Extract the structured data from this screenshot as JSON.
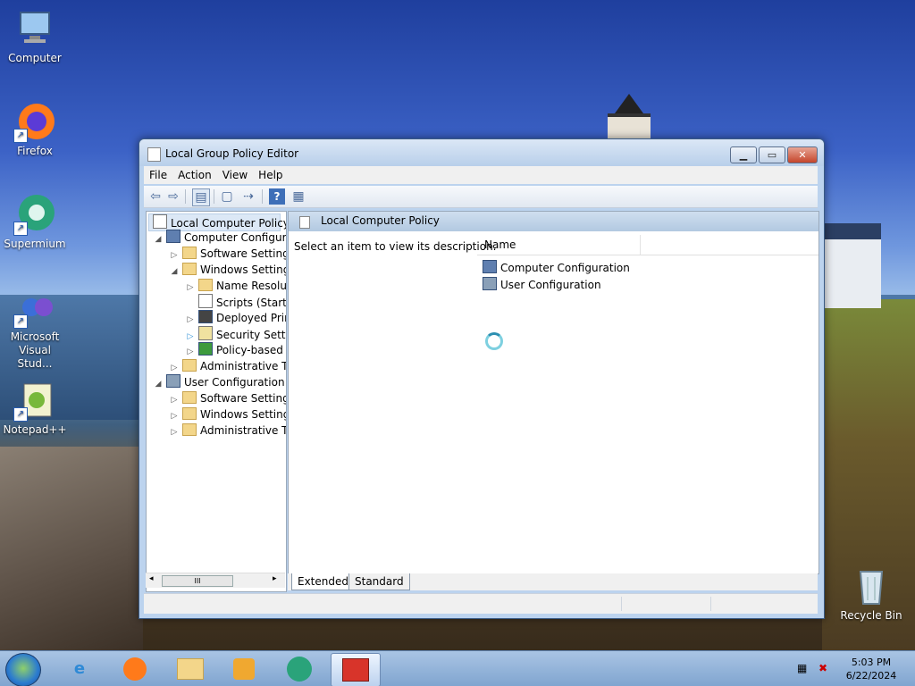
{
  "desktop": {
    "icons": [
      {
        "label": "Computer",
        "icon": "computer-icon"
      },
      {
        "label": "Firefox",
        "icon": "firefox-icon"
      },
      {
        "label": "Supermium",
        "icon": "supermium-icon"
      },
      {
        "label_line1": "Microsoft",
        "label_line2": "Visual Stud...",
        "icon": "visual-studio-icon"
      },
      {
        "label": "Notepad++",
        "icon": "notepadpp-icon"
      },
      {
        "label": "Recycle Bin",
        "icon": "recycle-bin-icon"
      }
    ]
  },
  "window": {
    "title": "Local Group Policy Editor",
    "menu": [
      "File",
      "Action",
      "View",
      "Help"
    ],
    "tree": {
      "root": "Local Computer Policy",
      "items": [
        "Computer Configura",
        "Software Settings",
        "Windows Setting",
        "Name Resolut",
        "Scripts (Startu",
        "Deployed Prir",
        "Security Settir",
        "Policy-based",
        "Administrative Te",
        "User Configuration",
        "Software Settings",
        "Windows Setting",
        "Administrative Te"
      ],
      "scroll_grip": "III"
    },
    "details": {
      "header": "Local Computer Policy",
      "description": "Select an item to view its description.",
      "column_name": "Name",
      "items": [
        "Computer Configuration",
        "User Configuration"
      ]
    },
    "tabs": [
      "Extended",
      "Standard"
    ]
  },
  "taskbar": {
    "apps": [
      "internet-explorer-icon",
      "firefox-icon",
      "explorer-icon",
      "media-player-icon",
      "supermium-icon",
      "group-policy-icon"
    ],
    "clock_time": "5:03 PM",
    "clock_date": "6/22/2024"
  },
  "colors": {
    "accent": "#3a5b85",
    "selection": "#dce8f6"
  }
}
